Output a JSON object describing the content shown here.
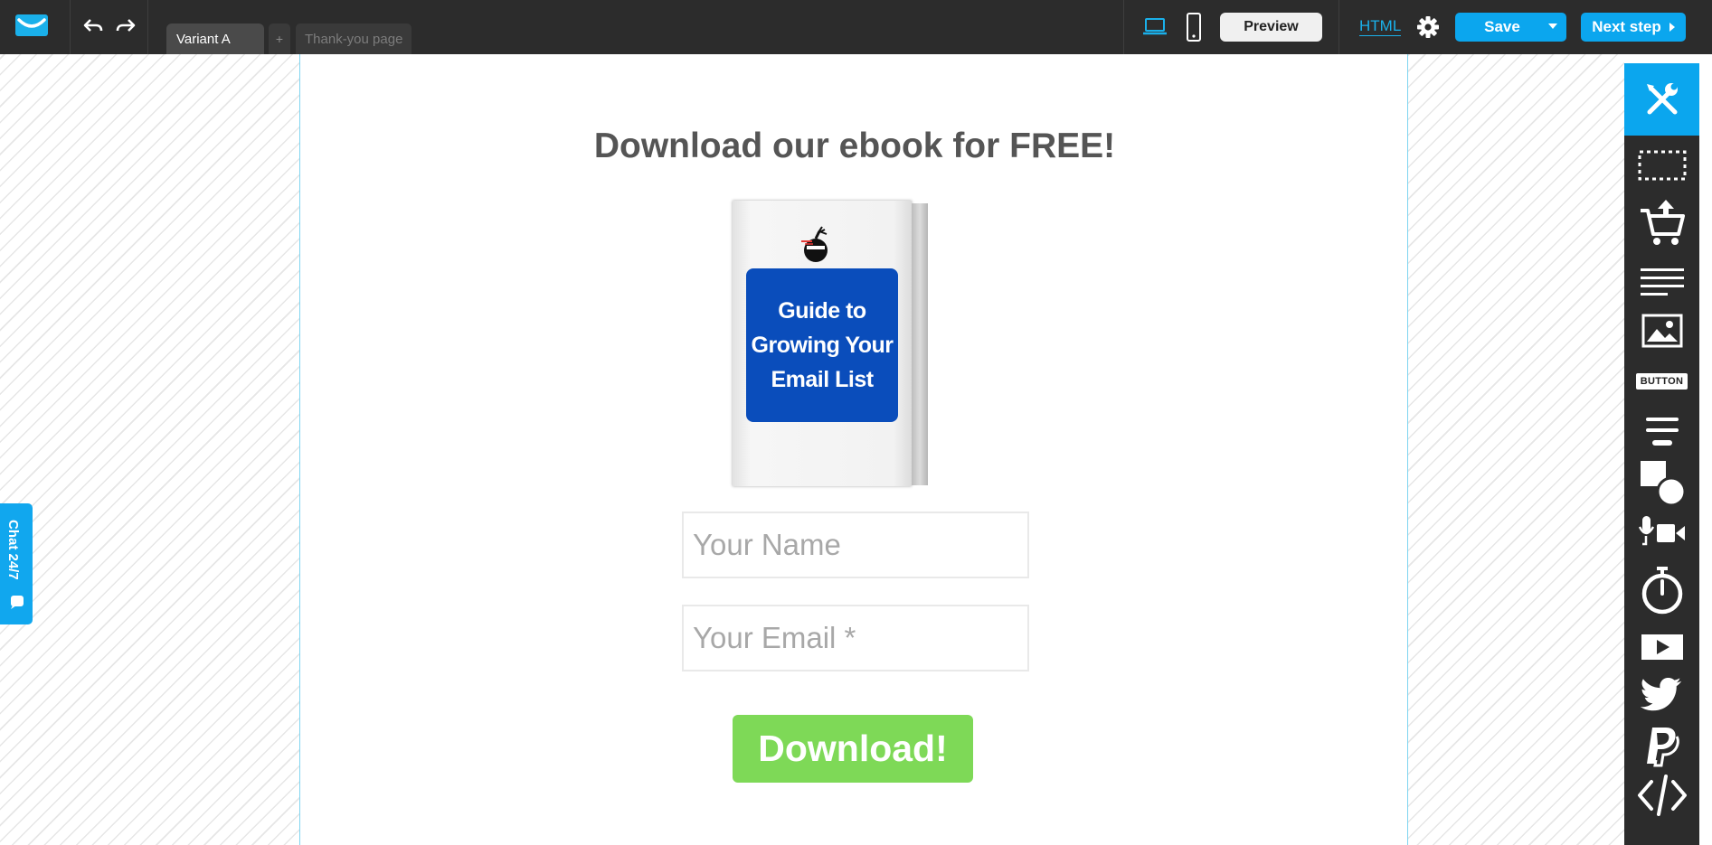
{
  "topbar": {
    "tabs": [
      {
        "label": "Variant A",
        "active": true
      },
      {
        "label": "+"
      },
      {
        "label": "Thank-you page"
      }
    ],
    "preview_label": "Preview",
    "html_label": "HTML",
    "save_label": "Save",
    "next_label": "Next step"
  },
  "page": {
    "headline": "Download our ebook for FREE!",
    "ebook": {
      "title": "Guide to Growing Your Email List"
    },
    "name_placeholder": "Your Name",
    "email_placeholder": "Your Email *",
    "cta_label": "Download!"
  },
  "chat": {
    "label": "Chat 24/7"
  },
  "toolbar": {
    "items": [
      "tools-icon",
      "section-icon",
      "cart-icon",
      "text-icon",
      "image-icon",
      "button-icon",
      "lines-icon",
      "shapes-icon",
      "media-icon",
      "timer-icon",
      "video-icon",
      "twitter-icon",
      "paypal-icon",
      "code-icon"
    ],
    "button_chip_label": "BUTTON"
  },
  "colors": {
    "accent": "#0ba6ee",
    "cta": "#7ed957",
    "ebook_blue": "#0a4dbb",
    "topbar": "#2c2c2c"
  }
}
